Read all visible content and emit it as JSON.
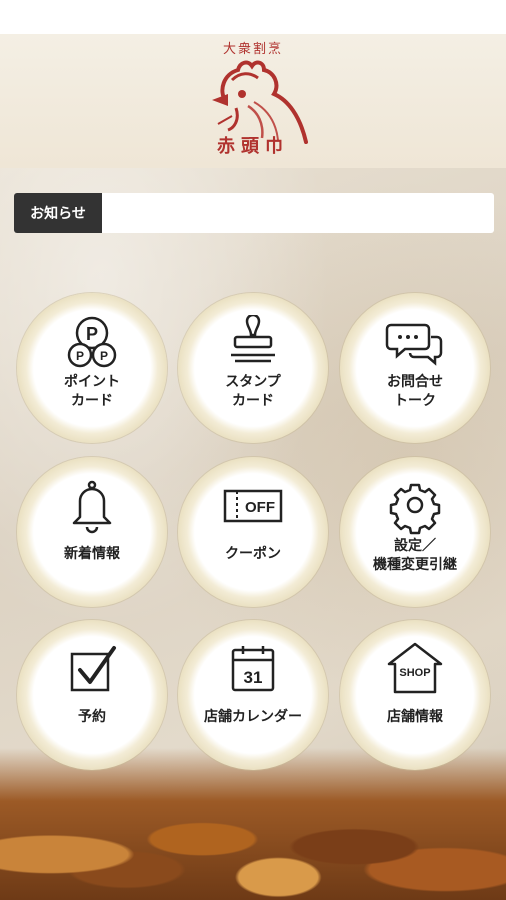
{
  "header": {
    "logo_top_text": "大衆割烹",
    "logo_bottom_text": "赤頭巾"
  },
  "notice": {
    "label": "お知らせ",
    "text": ""
  },
  "menu": [
    {
      "id": "point-card",
      "label": "ポイント\nカード",
      "icon": "point-card-icon"
    },
    {
      "id": "stamp-card",
      "label": "スタンプ\nカード",
      "icon": "stamp-icon"
    },
    {
      "id": "inquiry-talk",
      "label": "お問合せ\nトーク",
      "icon": "chat-bubbles-icon"
    },
    {
      "id": "news",
      "label": "新着情報",
      "icon": "bell-icon"
    },
    {
      "id": "coupon",
      "label": "クーポン",
      "icon": "coupon-off-icon",
      "icon_text": "OFF"
    },
    {
      "id": "settings",
      "label": "設定／\n機種変更引継",
      "icon": "gear-icon"
    },
    {
      "id": "reservation",
      "label": "予約",
      "icon": "checkbox-icon"
    },
    {
      "id": "store-calendar",
      "label": "店舗カレンダー",
      "icon": "calendar-icon",
      "icon_text": "31"
    },
    {
      "id": "store-info",
      "label": "店舗情報",
      "icon": "shop-icon",
      "icon_text": "SHOP"
    }
  ],
  "colors": {
    "logo_red": "#b0322e",
    "notice_label_bg": "#333333"
  }
}
